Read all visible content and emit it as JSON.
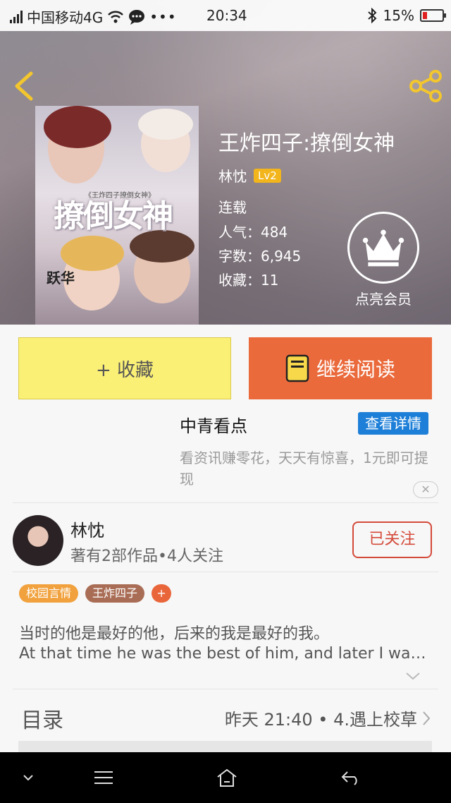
{
  "status_bar": {
    "carrier": "中国移动4G",
    "time": "20:34",
    "battery": "15%"
  },
  "book": {
    "title": "王炸四子:撩倒女神",
    "author": "林忱",
    "level": "Lv2",
    "status": "连载",
    "popularity": "人气：484",
    "word_count": "字数：6,945",
    "favorites": "收藏：11",
    "cover_title": "撩倒女神",
    "cover_subtitle": "《王炸四子撩倒女神》",
    "cover_mark": "跃华"
  },
  "member": {
    "label": "点亮会员"
  },
  "actions": {
    "favorite_label": "+ 收藏",
    "read_label": "继续阅读"
  },
  "ad": {
    "title": "中青看点",
    "details_label": "查看详情",
    "description": "看资讯赚零花，天天有惊喜，1元即可提现",
    "close_label": "✕"
  },
  "author_card": {
    "name": "林忱",
    "info": "著有2部作品•4人关注",
    "follow_label": "已关注"
  },
  "tags": [
    "校园言情",
    "王炸四子",
    "+"
  ],
  "description": {
    "line1": "当时的他是最好的他，后来的我是最好的我。",
    "line2": "At that time he was the best of him, and later I was the best of me."
  },
  "toc": {
    "label": "目录",
    "latest": "昨天 21:40 • 4.遇上校草"
  },
  "colors": {
    "favorite_bg": "#fbf076",
    "read_bg": "#ea6a3c",
    "ad_button": "#1e7fd8",
    "follow": "#d44a3a",
    "level_badge": "#f2b51c"
  }
}
